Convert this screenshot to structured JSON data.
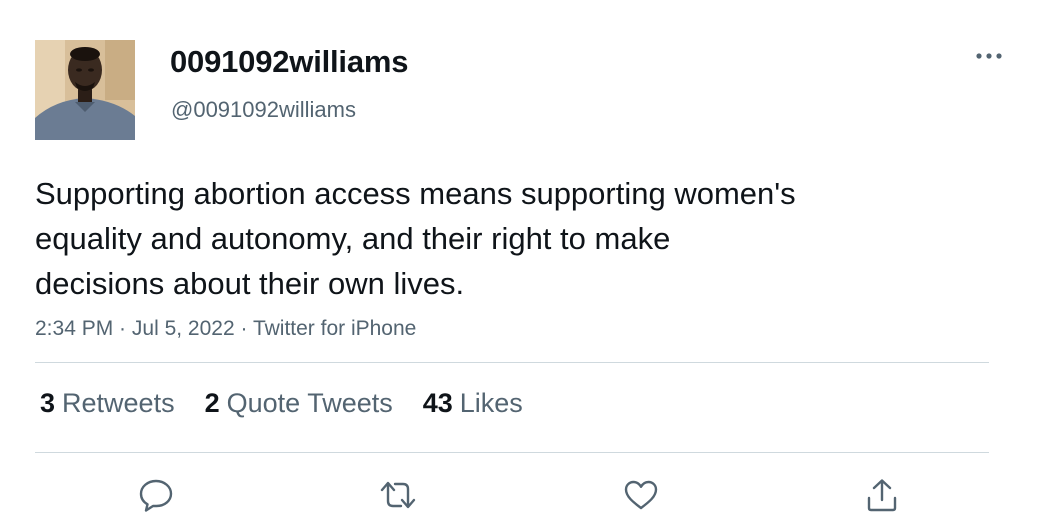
{
  "user": {
    "display_name": "0091092williams",
    "handle": "@0091092williams"
  },
  "tweet": {
    "lines": [
      "Supporting abortion access means supporting women's",
      "equality and autonomy, and their right to make",
      "decisions about their own lives."
    ],
    "time": "2:34 PM",
    "date": "Jul 5, 2022",
    "source": "Twitter for iPhone",
    "separator": " · "
  },
  "stats": {
    "retweets_count": "3",
    "retweets_label": "Retweets",
    "quotes_count": "2",
    "quotes_label": "Quote Tweets",
    "likes_count": "43",
    "likes_label": "Likes"
  },
  "icons": {
    "more": "more-icon",
    "reply": "reply-icon",
    "retweet": "retweet-icon",
    "like": "like-icon",
    "share": "share-icon"
  },
  "colors": {
    "text_primary": "#0f1419",
    "text_secondary": "#536471",
    "divider": "#cfd9de"
  }
}
